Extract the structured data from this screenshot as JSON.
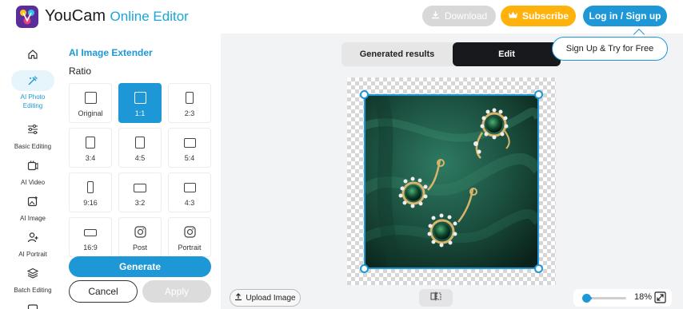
{
  "brand": {
    "name": "YouCam",
    "subtitle": "Online Editor"
  },
  "header": {
    "download_label": "Download",
    "subscribe_label": "Subscribe",
    "login_label": "Log in / Sign up",
    "tooltip": "Sign Up & Try for Free"
  },
  "nav": {
    "items": [
      {
        "label": "",
        "icon": "home-icon"
      },
      {
        "label": "AI Photo Editing",
        "icon": "magic-wand-icon",
        "active": true
      },
      {
        "label": "Basic Editing",
        "icon": "sliders-icon"
      },
      {
        "label": "AI Video",
        "icon": "video-icon"
      },
      {
        "label": "AI Image",
        "icon": "image-plus-icon"
      },
      {
        "label": "AI Portrait",
        "icon": "person-plus-icon"
      },
      {
        "label": "Batch Editing",
        "icon": "layers-icon"
      }
    ]
  },
  "panel": {
    "title": "AI Image Extender",
    "ratio_label": "Ratio",
    "ratios": [
      {
        "label": "Original",
        "icon": "square-icon"
      },
      {
        "label": "1:1",
        "icon": "square-icon",
        "selected": true
      },
      {
        "label": "2:3",
        "icon": "portrait-rect-icon"
      },
      {
        "label": "3:4",
        "icon": "portrait-rect-icon"
      },
      {
        "label": "4:5",
        "icon": "portrait-rect-icon"
      },
      {
        "label": "5:4",
        "icon": "landscape-rect-icon"
      },
      {
        "label": "9:16",
        "icon": "portrait-rect-icon"
      },
      {
        "label": "3:2",
        "icon": "landscape-rect-icon"
      },
      {
        "label": "4:3",
        "icon": "landscape-rect-icon"
      },
      {
        "label": "16:9",
        "icon": "landscape-rect-icon"
      },
      {
        "label": "Post",
        "icon": "instagram-icon"
      },
      {
        "label": "Portrait",
        "icon": "instagram-icon"
      }
    ],
    "generate_label": "Generate",
    "cancel_label": "Cancel",
    "apply_label": "Apply"
  },
  "workspace": {
    "tab_generated": "Generated results",
    "tab_edit": "Edit",
    "upload_label": "Upload Image",
    "zoom_text": "18%",
    "zoom_level": 0.18
  },
  "colors": {
    "accent": "#1d97d6",
    "subscribe": "#ffb20b",
    "edit_tab": "#17191c",
    "velvet": "#1f5a47"
  }
}
